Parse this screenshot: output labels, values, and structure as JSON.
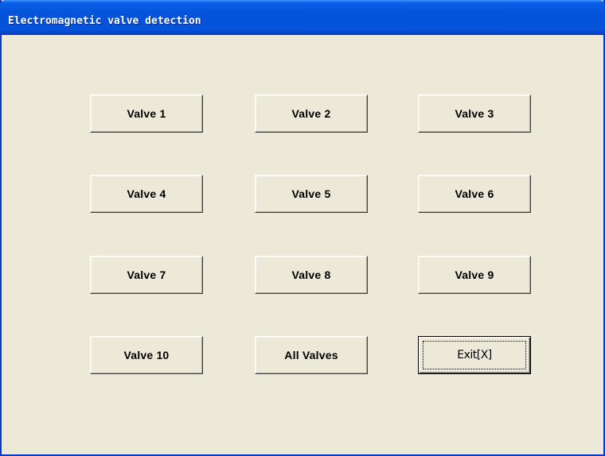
{
  "window": {
    "title": "Electromagnetic valve detection"
  },
  "buttons": {
    "valve_1": "Valve 1",
    "valve_2": "Valve 2",
    "valve_3": "Valve 3",
    "valve_4": "Valve 4",
    "valve_5": "Valve 5",
    "valve_6": "Valve 6",
    "valve_7": "Valve 7",
    "valve_8": "Valve 8",
    "valve_9": "Valve 9",
    "valve_10": "Valve 10",
    "all_valves": "All Valves",
    "exit": "Exit[X]"
  },
  "colors": {
    "window_bg": "#ece9d8",
    "titlebar": "#0453d8",
    "title_text": "#ffffff",
    "frame": "#0a3bc1"
  }
}
